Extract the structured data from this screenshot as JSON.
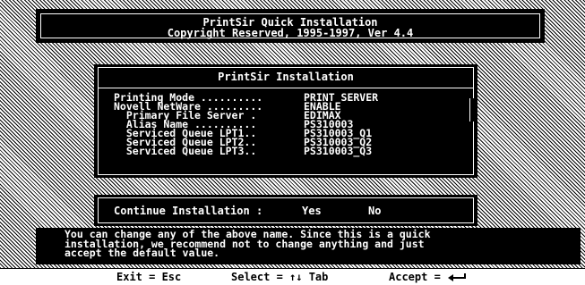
{
  "banner": {
    "title": "PrintSir Quick Installation",
    "copyright": "Copyright Reserved, 1995-1997, Ver 4.4"
  },
  "dialog": {
    "title": "PrintSir Installation",
    "rows": [
      {
        "label": "Printing Mode ..........",
        "value": "PRINT SERVER"
      },
      {
        "label": "Novell NetWare .........",
        "value": "ENABLE"
      },
      {
        "label": "  Primary File Server .",
        "value": "EDIMAX"
      },
      {
        "label": "  Alias Name ..........",
        "value": "PS310003"
      },
      {
        "label": "  Serviced Queue LPT1..",
        "value": "PS310003_Q1"
      },
      {
        "label": "  Serviced Queue LPT2..",
        "value": "PS310003_Q2"
      },
      {
        "label": "  Serviced Queue LPT3..",
        "value": "PS310003_Q3"
      }
    ]
  },
  "continue_dialog": {
    "label": "Continue Installation :",
    "yes": "Yes",
    "no": "No"
  },
  "help": {
    "line1": "You can change any of the above name. Since this is a quick",
    "line2": "installation, we recommend not to change anything and just",
    "line3": "accept the default value."
  },
  "keys": {
    "exit": "Exit = Esc",
    "select": "Select = ↑↓ Tab",
    "accept": "Accept = "
  },
  "icons": {
    "enter": "enter-arrow-icon"
  }
}
